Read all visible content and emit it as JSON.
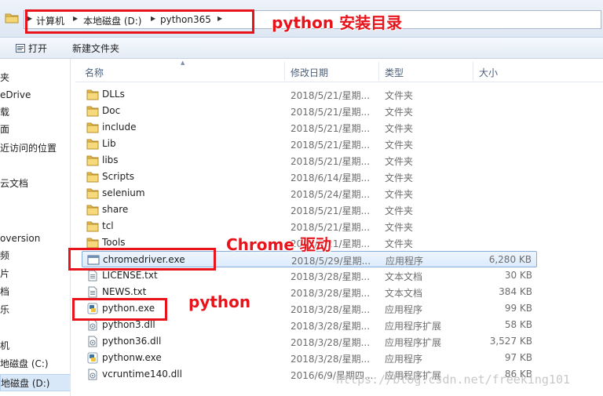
{
  "breadcrumb": [
    "计算机",
    "本地磁盘 (D:)",
    "python365"
  ],
  "toolbar": {
    "open_label": "打开",
    "new_folder_label": "新建文件夹"
  },
  "nav": [
    "夹",
    "eDrive",
    "载",
    "面",
    "近访问的位置",
    "云文档",
    "oversion",
    "频",
    "片",
    "档",
    "乐",
    "机",
    "地磁盘 (C:)",
    "地磁盘 (D:)"
  ],
  "columns": {
    "name": "名称",
    "modified": "修改日期",
    "type": "类型",
    "size": "大小"
  },
  "files": [
    {
      "name": "DLLs",
      "date": "2018/5/21/星期...",
      "type": "文件夹",
      "size": "",
      "icon": "folder-icon"
    },
    {
      "name": "Doc",
      "date": "2018/5/21/星期...",
      "type": "文件夹",
      "size": "",
      "icon": "folder-icon"
    },
    {
      "name": "include",
      "date": "2018/5/21/星期...",
      "type": "文件夹",
      "size": "",
      "icon": "folder-icon"
    },
    {
      "name": "Lib",
      "date": "2018/5/21/星期...",
      "type": "文件夹",
      "size": "",
      "icon": "folder-icon"
    },
    {
      "name": "libs",
      "date": "2018/5/21/星期...",
      "type": "文件夹",
      "size": "",
      "icon": "folder-icon"
    },
    {
      "name": "Scripts",
      "date": "2018/6/14/星期...",
      "type": "文件夹",
      "size": "",
      "icon": "folder-icon"
    },
    {
      "name": "selenium",
      "date": "2018/5/24/星期...",
      "type": "文件夹",
      "size": "",
      "icon": "folder-icon"
    },
    {
      "name": "share",
      "date": "2018/5/21/星期...",
      "type": "文件夹",
      "size": "",
      "icon": "folder-icon"
    },
    {
      "name": "tcl",
      "date": "2018/5/21/星期...",
      "type": "文件夹",
      "size": "",
      "icon": "folder-icon"
    },
    {
      "name": "Tools",
      "date": "2018/5/21/星期...",
      "type": "文件夹",
      "size": "",
      "icon": "folder-icon"
    },
    {
      "name": "chromedriver.exe",
      "date": "2018/5/29/星期...",
      "type": "应用程序",
      "size": "6,280 KB",
      "icon": "exe-icon"
    },
    {
      "name": "LICENSE.txt",
      "date": "2018/3/28/星期...",
      "type": "文本文档",
      "size": "30 KB",
      "icon": "text-file-icon"
    },
    {
      "name": "NEWS.txt",
      "date": "2018/3/28/星期...",
      "type": "文本文档",
      "size": "384 KB",
      "icon": "text-file-icon"
    },
    {
      "name": "python.exe",
      "date": "2018/3/28/星期...",
      "type": "应用程序",
      "size": "99 KB",
      "icon": "python-icon"
    },
    {
      "name": "python3.dll",
      "date": "2018/3/28/星期...",
      "type": "应用程序扩展",
      "size": "58 KB",
      "icon": "dll-icon"
    },
    {
      "name": "python36.dll",
      "date": "2018/3/28/星期...",
      "type": "应用程序扩展",
      "size": "3,527 KB",
      "icon": "dll-icon"
    },
    {
      "name": "pythonw.exe",
      "date": "2018/3/28/星期...",
      "type": "应用程序",
      "size": "97 KB",
      "icon": "python-icon"
    },
    {
      "name": "vcruntime140.dll",
      "date": "2016/6/9/星期四...",
      "type": "应用程序扩展",
      "size": "86 KB",
      "icon": "dll-icon"
    }
  ],
  "selected_file": "chromedriver.exe",
  "selected_nav": "地磁盘 (D:)",
  "annotations": {
    "install_dir": "python 安装目录",
    "chrome_driver": "Chrome 驱动",
    "python": "python"
  },
  "watermark": "https://blog.csdn.net/freeking101",
  "colors": {
    "annotation": "#e8141b",
    "selection": "#d9e8f8",
    "folder": "#e8c35a"
  }
}
